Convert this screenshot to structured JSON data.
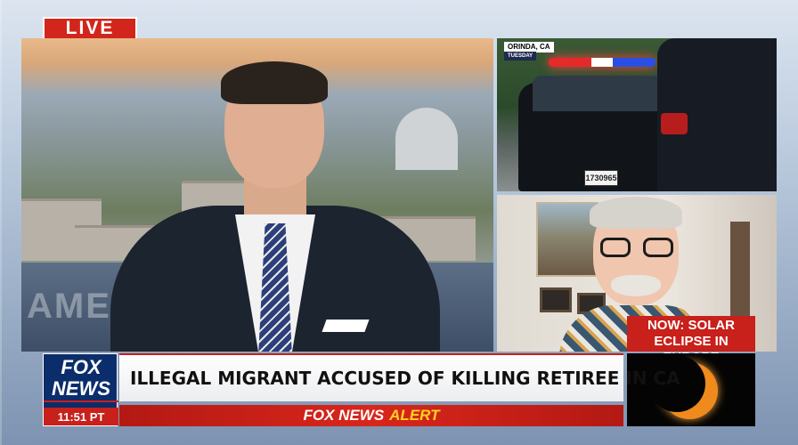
{
  "live_badge": "LIVE",
  "wall_text": "AMERICA",
  "police_feed": {
    "location": "ORINDA, CA",
    "day": "TUESDAY",
    "plate": "1730965"
  },
  "eclipse_promo": {
    "label": "NOW: SOLAR ECLIPSE IN EUROPE"
  },
  "network_logo": {
    "line1": "FOX",
    "line2": "NEWS",
    "time": "11:51 PT"
  },
  "headline": "ILLEGAL MIGRANT ACCUSED OF KILLING RETIREE IN CA",
  "alert": {
    "brand": "FOX NEWS",
    "word": "ALERT"
  },
  "colors": {
    "alert_red": "#c8201a",
    "fox_blue": "#0b2d6b",
    "alert_yellow": "#ffd21f",
    "eclipse_orange": "#f08a1d"
  }
}
